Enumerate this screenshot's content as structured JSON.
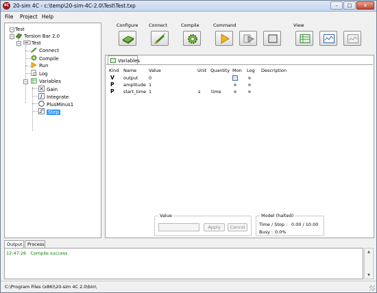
{
  "window": {
    "title": "20-sim 4C - c:\\temp\\20-sim-4C-2.0\\Test\\Test.txp",
    "app_icon_text": "4C",
    "minimize": "–",
    "maximize": "□",
    "close": "x"
  },
  "menu": {
    "file": "File",
    "project": "Project",
    "help": "Help"
  },
  "tree": {
    "root": "Test",
    "model": "Torsion Bar 2.0",
    "target": "Test",
    "items": {
      "connect": "Connect",
      "compile": "Compile",
      "run": "Run",
      "log": "Log",
      "variables": "Variables",
      "gain": "Gain",
      "integrate": "Integrate",
      "plusminus": "PlusMinus1",
      "step": "Step"
    }
  },
  "toolbar": {
    "configure": "Configure",
    "connect": "Connect",
    "compile": "Compile",
    "command": "Command",
    "view": "View"
  },
  "variables_tab": {
    "label": "Variables",
    "columns": [
      "Kind",
      "Name",
      "Value",
      "Unit",
      "Quantity",
      "Mon",
      "Log",
      "Description"
    ],
    "rows": [
      {
        "kind": "V",
        "name": "output",
        "value": "0",
        "unit": "",
        "quantity": ""
      },
      {
        "kind": "P",
        "name": "amplitude",
        "value": "1",
        "unit": "",
        "quantity": ""
      },
      {
        "kind": "P",
        "name": "start_time",
        "value": "1",
        "unit": "s",
        "quantity": "time"
      }
    ]
  },
  "value_group": {
    "label": "Value",
    "input_value": "",
    "apply": "Apply",
    "cancel": "Cancel"
  },
  "model_group": {
    "label": "Model (halted)",
    "time_label": "Time / Stop :",
    "time_value": "0.00 / 10.00",
    "busy_label": "Busy :",
    "busy_value": "0.0%"
  },
  "output_tabs": {
    "output": "Output",
    "process": "Process"
  },
  "log": {
    "time": "12:47:26",
    "message": "Compile success"
  },
  "statusbar": {
    "path": "C:\\Program Files (x86)\\20-sim 4C 2.0\\bin\\"
  },
  "colors": {
    "accent": "#3399ff",
    "log_green": "#008000",
    "title_bg": "#c2d5ee"
  }
}
